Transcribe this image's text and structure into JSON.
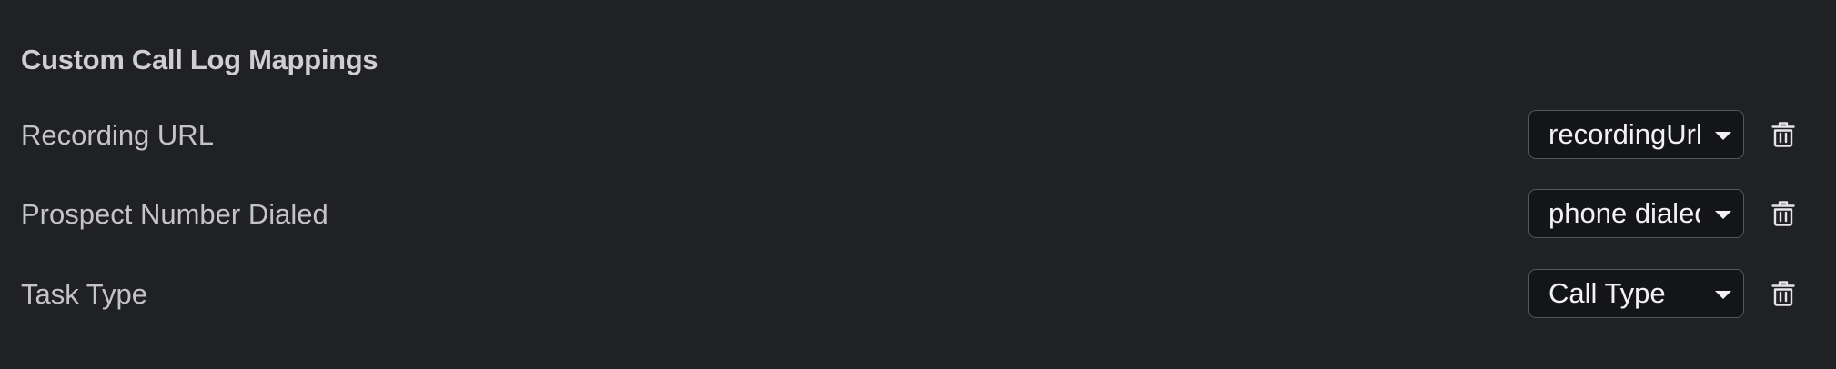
{
  "section": {
    "title": "Custom Call Log Mappings"
  },
  "rows": [
    {
      "label": "Recording URL",
      "select_value": "recordingUrl",
      "delete_icon": "trash-icon",
      "dropdown_icon": "caret-down-icon"
    },
    {
      "label": "Prospect Number Dialed",
      "select_value": "phone dialed",
      "delete_icon": "trash-icon",
      "dropdown_icon": "caret-down-icon"
    },
    {
      "label": "Task Type",
      "select_value": "Call Type",
      "delete_icon": "trash-icon",
      "dropdown_icon": "caret-down-icon"
    }
  ],
  "colors": {
    "background": "#202125",
    "text": "#c4c4c7",
    "select_background": "#141517",
    "select_border": "#55565b",
    "select_text": "#f2f2f4"
  }
}
